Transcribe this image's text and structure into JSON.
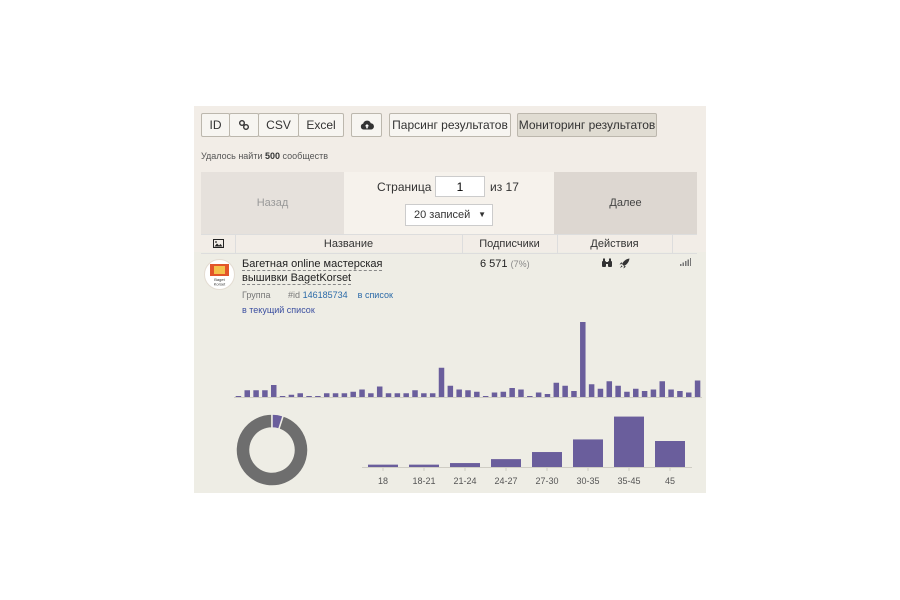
{
  "toolbar": {
    "id_label": "ID",
    "csv_label": "CSV",
    "excel_label": "Excel",
    "parse_label": "Парсинг результатов",
    "monitor_label": "Мониторинг результатов"
  },
  "found": {
    "prefix": "Удалось найти",
    "count": "500",
    "suffix": "сообществ"
  },
  "pager": {
    "prev_label": "Назад",
    "next_label": "Далее",
    "page_label": "Страница",
    "page_value": "1",
    "of_label": "из 17",
    "per_page": "20 записей"
  },
  "table": {
    "col_name": "Название",
    "col_subs": "Подписчики",
    "col_actions": "Действия"
  },
  "row": {
    "name": "Багетная online мастерская вышивки BagetKorset",
    "avatar_text": "Baget Korset",
    "type": "Группа",
    "id_prefix": "#id",
    "id_value": "146185734",
    "in_list": "в список",
    "in_current_list": "в текущий список",
    "subscribers": "6 571",
    "subscribers_pct": "(7%)"
  },
  "colors": {
    "bar": "#6a5e9c",
    "donut_main": "#6e6e6e",
    "donut_alt": "#6a5e9c"
  },
  "chart_data": [
    {
      "type": "bar",
      "values": [
        1,
        9,
        9,
        9,
        16,
        1,
        3,
        5,
        1,
        0,
        5,
        5,
        5,
        7,
        10,
        5,
        14,
        5,
        5,
        5,
        9,
        5,
        5,
        39,
        15,
        10,
        9,
        7,
        0,
        6,
        7,
        12,
        10,
        0,
        6,
        4,
        19,
        15,
        8,
        100,
        17,
        11,
        21,
        15,
        7,
        11,
        8,
        10,
        21,
        10,
        8,
        6,
        22
      ]
    },
    {
      "type": "pie",
      "values": [
        95,
        5
      ]
    },
    {
      "type": "bar",
      "categories": [
        "18",
        "18-21",
        "21-24",
        "24-27",
        "27-30",
        "30-35",
        "35-45",
        "45"
      ],
      "values": [
        3,
        3,
        5,
        10,
        19,
        35,
        64,
        33
      ]
    }
  ]
}
